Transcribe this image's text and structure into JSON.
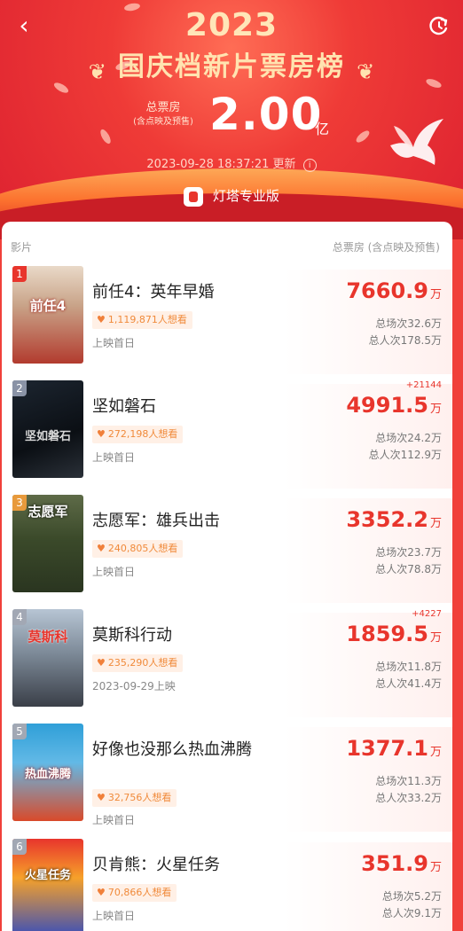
{
  "header": {
    "year": "2023",
    "title": "国庆档新片票房榜",
    "total_label": "总票房",
    "total_sub": "(含点映及预售)",
    "total_value": "2.00",
    "total_unit": "亿",
    "update_text": "2023-09-28 18:37:21 更新",
    "brand": "灯塔专业版"
  },
  "columns": {
    "film": "影片",
    "box": "总票房 (含点映及预售)"
  },
  "movies": [
    {
      "rank": "1",
      "title": "前任4：英年早婚",
      "poster_text": "前任4",
      "want": "1,119,871人想看",
      "release": "上映首日",
      "delta": "",
      "box": "7660.9",
      "unit": "万",
      "shows": "总场次32.6万",
      "admissions": "总人次178.5万"
    },
    {
      "rank": "2",
      "title": "坚如磐石",
      "poster_text": "坚如磐石",
      "want": "272,198人想看",
      "release": "上映首日",
      "delta": "+21144",
      "box": "4991.5",
      "unit": "万",
      "shows": "总场次24.2万",
      "admissions": "总人次112.9万"
    },
    {
      "rank": "3",
      "title": "志愿军：雄兵出击",
      "poster_text": "志愿军",
      "want": "240,805人想看",
      "release": "上映首日",
      "delta": "",
      "box": "3352.2",
      "unit": "万",
      "shows": "总场次23.7万",
      "admissions": "总人次78.8万"
    },
    {
      "rank": "4",
      "title": "莫斯科行动",
      "poster_text": "莫斯科",
      "want": "235,290人想看",
      "release": "2023-09-29上映",
      "delta": "+4227",
      "box": "1859.5",
      "unit": "万",
      "shows": "总场次11.8万",
      "admissions": "总人次41.4万"
    },
    {
      "rank": "5",
      "title": "好像也没那么热血沸腾",
      "poster_text": "热血沸腾",
      "want": "32,756人想看",
      "release": "上映首日",
      "delta": "",
      "box": "1377.1",
      "unit": "万",
      "shows": "总场次11.3万",
      "admissions": "总人次33.2万"
    },
    {
      "rank": "6",
      "title": "贝肯熊：火星任务",
      "poster_text": "火星任务",
      "want": "70,866人想看",
      "release": "上映首日",
      "delta": "",
      "box": "351.9",
      "unit": "万",
      "shows": "总场次5.2万",
      "admissions": "总人次9.1万"
    }
  ]
}
